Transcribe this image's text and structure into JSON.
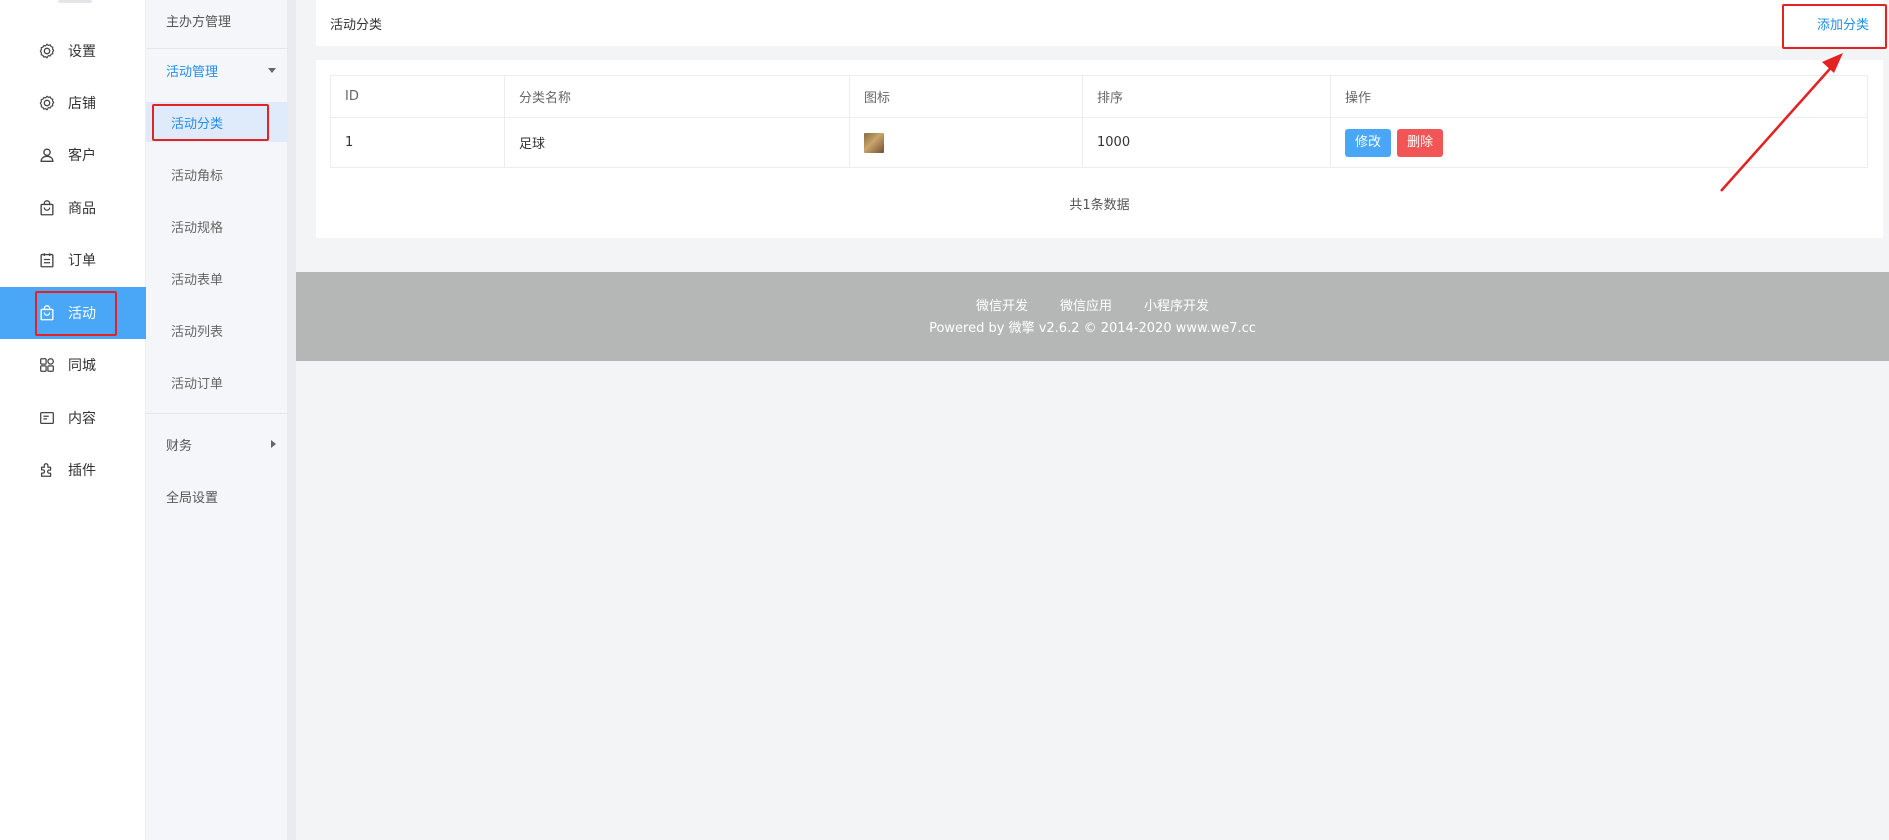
{
  "nav": {
    "items": [
      {
        "label": "设置",
        "icon": "gear-icon"
      },
      {
        "label": "店铺",
        "icon": "store-gear-icon"
      },
      {
        "label": "客户",
        "icon": "user-icon"
      },
      {
        "label": "商品",
        "icon": "bag-icon"
      },
      {
        "label": "订单",
        "icon": "order-list-icon"
      },
      {
        "label": "活动",
        "icon": "activity-bag-icon",
        "active": true
      },
      {
        "label": "同城",
        "icon": "grid-icon"
      },
      {
        "label": "内容",
        "icon": "content-icon"
      },
      {
        "label": "插件",
        "icon": "plugin-icon"
      }
    ]
  },
  "subnav": {
    "top_item": "主办方管理",
    "group_activity": "活动管理",
    "items": [
      "活动分类",
      "活动角标",
      "活动规格",
      "活动表单",
      "活动列表",
      "活动订单"
    ],
    "group_finance": "财务",
    "global_settings": "全局设置"
  },
  "header": {
    "title": "活动分类",
    "add_label": "添加分类"
  },
  "table": {
    "columns": [
      "ID",
      "分类名称",
      "图标",
      "排序",
      "操作"
    ],
    "rows": [
      {
        "id": "1",
        "name": "足球",
        "sort": "1000",
        "edit": "修改",
        "delete": "删除"
      }
    ]
  },
  "total_text": "共1条数据",
  "footer": {
    "links": [
      "微信开发",
      "微信应用",
      "小程序开发"
    ],
    "copyright": "Powered by 微擎 v2.6.2 © 2014-2020 www.we7.cc"
  },
  "colors": {
    "accent": "#4aa6f6",
    "link": "#1f8ef1",
    "danger": "#f25555",
    "annotation": "#e52222",
    "footer_bg": "#b5b6b6"
  }
}
